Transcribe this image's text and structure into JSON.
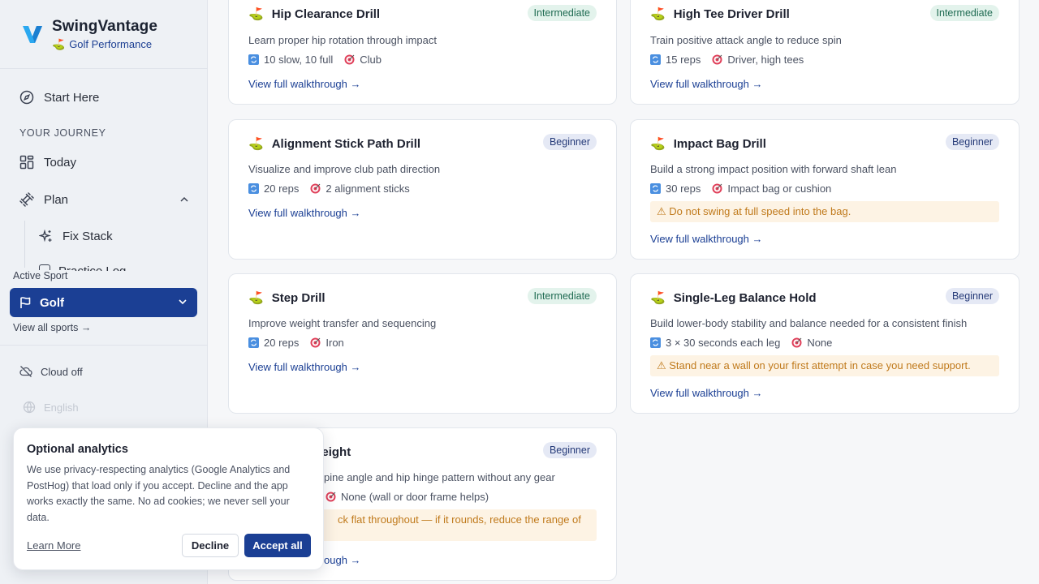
{
  "brand": {
    "name": "SwingVantage",
    "subtitle": "Golf Performance"
  },
  "nav": {
    "start_here": "Start Here",
    "section_label": "YOUR JOURNEY",
    "today": "Today",
    "plan": "Plan",
    "fix_stack": "Fix Stack",
    "clipped_item": "Practice Log"
  },
  "sport": {
    "label": "Active Sport",
    "selected": "Golf",
    "view_all": "View all sports →"
  },
  "footer": {
    "cloud": "Cloud off",
    "language": "English"
  },
  "cards": [
    {
      "title": "Hip Clearance Drill",
      "level": "Intermediate",
      "description": "Learn proper hip rotation through impact",
      "reps": "10 slow, 10 full",
      "equipment": "Club",
      "link": "View full walkthrough →"
    },
    {
      "title": "High Tee Driver Drill",
      "level": "Intermediate",
      "description": "Train positive attack angle to reduce spin",
      "reps": "15 reps",
      "equipment": "Driver, high tees",
      "link": "View full walkthrough →"
    },
    {
      "title": "Alignment Stick Path Drill",
      "level": "Beginner",
      "description": "Visualize and improve club path direction",
      "reps": "20 reps",
      "equipment": "2 alignment sticks",
      "link": "View full walkthrough →"
    },
    {
      "title": "Impact Bag Drill",
      "level": "Beginner",
      "description": "Build a strong impact position with forward shaft lean",
      "reps": "30 reps",
      "equipment": "Impact bag or cushion",
      "warning": "⚠ Do not swing at full speed into the bag.",
      "link": "View full walkthrough →"
    },
    {
      "title": "Step Drill",
      "level": "Intermediate",
      "description": "Improve weight transfer and sequencing",
      "reps": "20 reps",
      "equipment": "Iron",
      "link": "View full walkthrough →"
    },
    {
      "title": "Single-Leg Balance Hold",
      "level": "Beginner",
      "description": "Build lower-body stability and balance needed for a consistent finish",
      "reps": "3 × 30 seconds each leg",
      "equipment": "None",
      "warning": "⚠ Stand near a wall on your first attempt in case you need support.",
      "link": "View full walkthrough →"
    },
    {
      "title": "e Bodyweight",
      "level": "Beginner",
      "description": "pine angle and hip hinge pattern without any gear",
      "equipment": "None (wall or door frame helps)",
      "warning": "ck flat throughout — if it rounds, reduce the range of",
      "link": "ough →"
    }
  ],
  "cookie": {
    "title": "Optional analytics",
    "body": "We use privacy-respecting analytics (Google Analytics and PostHog) that load only if you accept. Decline and the app works exactly the same. No ad cookies; we never sell your data.",
    "learn_more": "Learn More",
    "decline": "Decline",
    "accept": "Accept all"
  },
  "colors": {
    "accent": "#1b3f94",
    "badge_intermediate_bg": "#e3f3ec",
    "badge_beginner_bg": "#e5e9f5",
    "warning_bg": "#fdf3e4",
    "warning_text": "#c07a1c"
  }
}
